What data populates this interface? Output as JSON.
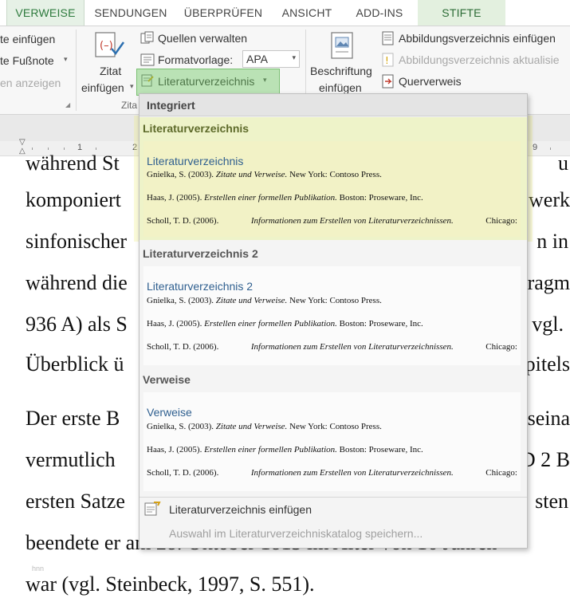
{
  "tabs": [
    {
      "label": "VERWEISE",
      "active": true
    },
    {
      "label": "SENDUNGEN"
    },
    {
      "label": "ÜBERPRÜFEN"
    },
    {
      "label": "ANSICHT"
    },
    {
      "label": "ADD-INS"
    },
    {
      "label": "STIFTE"
    }
  ],
  "ribbon": {
    "footnotes": {
      "insert_footnote": "te einfügen",
      "next_footnote": "te Fußnote",
      "show_notes": "en anzeigen"
    },
    "citations": {
      "insert_citation_line1": "Zitat",
      "insert_citation_line2": "einfügen",
      "group_label": "Zita",
      "manage_sources": "Quellen verwalten",
      "style_label": "Formatvorlage:",
      "style_value": "APA",
      "bibliography": "Literaturverzeichnis"
    },
    "captions": {
      "insert_caption_line1": "Beschriftung",
      "insert_caption_line2": "einfügen",
      "insert_table_of_figures": "Abbildungsverzeichnis einfügen",
      "update_table": "Abbildungsverzeichnis aktualisie",
      "cross_reference": "Querverweis"
    }
  },
  "ruler": {
    "numbers": [
      "1",
      "2",
      "9"
    ]
  },
  "document": {
    "lines": [
      {
        "left": "während St",
        "right": "u"
      },
      {
        "left": "komponiert",
        "right": "werk"
      },
      {
        "left": "sinfonischer",
        "right": "n in"
      },
      {
        "left": "während die",
        "right": "Fragm"
      },
      {
        "left": "936 A) als S",
        "right": "vgl."
      },
      {
        "left": "Überblick ü",
        "right": "pitels"
      },
      {
        "left": "Der erste B",
        "right": "seina"
      },
      {
        "left": "vermutlich",
        "right": "D 2 B"
      },
      {
        "left": "ersten Satze",
        "right": "sten"
      },
      {
        "left": "beendete er am 28. Oktober 1813 im Alter von 16 Jahren",
        "right": ""
      },
      {
        "left": "war (vgl. Steinbeck, 1997, S. 551).",
        "right": ""
      }
    ],
    "footer_mark": "hnn"
  },
  "dropdown": {
    "header": "Integriert",
    "sections": [
      {
        "title": "Literaturverzeichnis",
        "preview_title": "Literaturverzeichnis",
        "entries": [
          {
            "author": "Gnielka, S. (2003).",
            "title": "Zitate und Verweise.",
            "rest": "New York: Contoso Press."
          },
          {
            "author": "Haas, J. (2005).",
            "title": "Erstellen einer formellen Publikation.",
            "rest": "Boston: Proseware, Inc."
          },
          {
            "author": "Scholl, T. D. (2006).",
            "title": "Informationen zum Erstellen von Literaturverzeichnissen.",
            "rest": "Chicago:"
          }
        ]
      },
      {
        "title": "Literaturverzeichnis 2",
        "preview_title": "Literaturverzeichnis 2",
        "entries": [
          {
            "author": "Gnielka, S. (2003).",
            "title": "Zitate und Verweise.",
            "rest": "New York: Contoso Press."
          },
          {
            "author": "Haas, J. (2005).",
            "title": "Erstellen einer formellen Publikation.",
            "rest": "Boston: Proseware, Inc."
          },
          {
            "author": "Scholl, T. D. (2006).",
            "title": "Informationen zum Erstellen von Literaturverzeichnissen.",
            "rest": "Chicago:"
          }
        ]
      },
      {
        "title": "Verweise",
        "preview_title": "Verweise",
        "entries": [
          {
            "author": "Gnielka, S. (2003).",
            "title": "Zitate und Verweise.",
            "rest": "New York: Contoso Press."
          },
          {
            "author": "Haas, J. (2005).",
            "title": "Erstellen einer formellen Publikation.",
            "rest": "Boston: Proseware, Inc."
          },
          {
            "author": "Scholl, T. D. (2006).",
            "title": "Informationen zum Erstellen von Literaturverzeichnissen.",
            "rest": "Chicago:"
          }
        ]
      }
    ],
    "commands": {
      "insert_bibliography": "Literaturverzeichnis einfügen",
      "save_to_gallery": "Auswahl im Literaturverzeichniskatalog speichern..."
    }
  },
  "colors": {
    "accent_green": "#2d7a3d",
    "highlight_green": "#6ec864",
    "highlight_yellow": "#f0f082",
    "link_blue": "#2f5f8f"
  }
}
